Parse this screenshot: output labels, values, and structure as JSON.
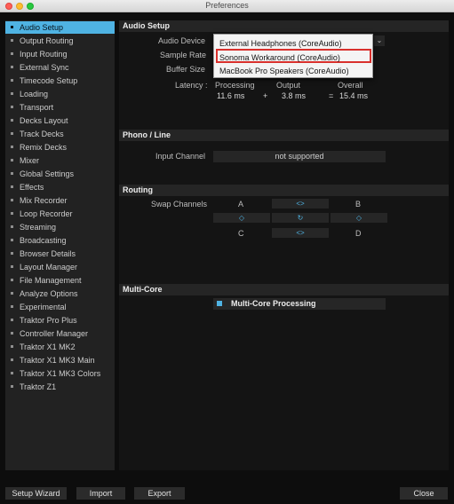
{
  "window": {
    "title": "Preferences"
  },
  "sidebar": {
    "items": [
      {
        "label": "Audio Setup",
        "active": true
      },
      {
        "label": "Output Routing"
      },
      {
        "label": "Input Routing"
      },
      {
        "label": "External Sync"
      },
      {
        "label": "Timecode Setup"
      },
      {
        "label": "Loading"
      },
      {
        "label": "Transport"
      },
      {
        "label": "Decks Layout"
      },
      {
        "label": "Track Decks"
      },
      {
        "label": "Remix Decks"
      },
      {
        "label": "Mixer"
      },
      {
        "label": "Global Settings"
      },
      {
        "label": "Effects"
      },
      {
        "label": "Mix Recorder"
      },
      {
        "label": "Loop Recorder"
      },
      {
        "label": "Streaming"
      },
      {
        "label": "Broadcasting"
      },
      {
        "label": "Browser Details"
      },
      {
        "label": "Layout Manager"
      },
      {
        "label": "File Management"
      },
      {
        "label": "Analyze Options"
      },
      {
        "label": "Experimental"
      },
      {
        "label": "Traktor Pro Plus"
      },
      {
        "label": "Controller Manager"
      },
      {
        "label": "Traktor X1 MK2"
      },
      {
        "label": "Traktor X1 MK3 Main"
      },
      {
        "label": "Traktor X1 MK3 Colors"
      },
      {
        "label": "Traktor Z1"
      }
    ]
  },
  "audio_setup": {
    "header": "Audio Setup",
    "audio_device_label": "Audio Device",
    "sample_rate_label": "Sample Rate",
    "buffer_size_label": "Buffer Size",
    "latency_label": "Latency :",
    "processing_label": "Processing",
    "output_label": "Output",
    "overall_label": "Overall",
    "processing_value": "11.6 ms",
    "plus": "+",
    "output_value": "3.8 ms",
    "equals": "=",
    "overall_value": "15.4 ms",
    "device_options": [
      "External Headphones (CoreAudio)",
      "Sonoma Workaround (CoreAudio)",
      "MacBook Pro Speakers (CoreAudio)"
    ],
    "selected_option": "Sonoma Workaround (CoreAudio)",
    "dropdown_arrow": "⌄"
  },
  "phono_line": {
    "header": "Phono / Line",
    "input_channel_label": "Input Channel",
    "input_channel_value": "not supported"
  },
  "routing": {
    "header": "Routing",
    "swap_channels_label": "Swap Channels",
    "a": "A",
    "b": "B",
    "c": "C",
    "d": "D",
    "swap_ab": "<>",
    "swap_ac": "◇",
    "reset": "↻",
    "swap_bd": "◇",
    "swap_cd": "<>"
  },
  "multi_core": {
    "header": "Multi-Core",
    "processing_label": "Multi-Core Processing",
    "enabled": true
  },
  "footer": {
    "setup_wizard": "Setup Wizard",
    "import": "Import",
    "export": "Export",
    "close": "Close"
  },
  "colors": {
    "accent": "#4fb3e3",
    "highlight_border": "#d9302c",
    "background": "#0d0d0d"
  }
}
